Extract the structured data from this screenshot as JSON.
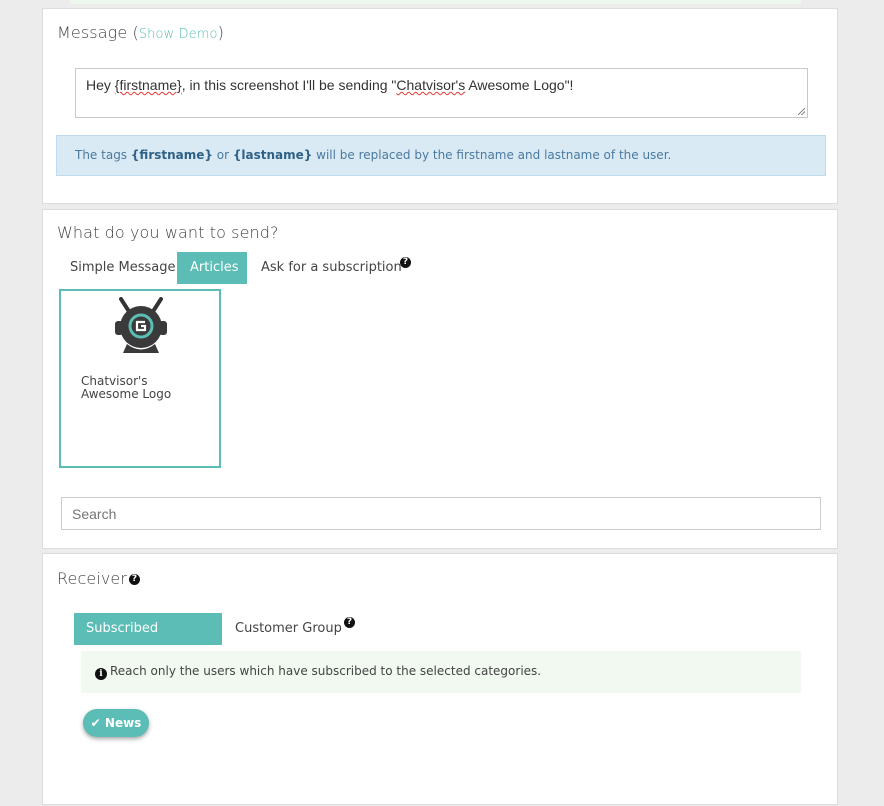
{
  "message_panel": {
    "title": "Message",
    "open_paren": "(",
    "show_demo_link": "Show Demo",
    "close_paren": ")",
    "message_parts": [
      "Hey ",
      "{firstname}",
      ", in this screenshot I'll be sending \"",
      "Chatvisor's",
      " Awesome Logo\"!"
    ],
    "info_parts": [
      "The tags ",
      "{firstname}",
      " or ",
      "{lastname}",
      " will be replaced by the firstname and lastname of the user."
    ]
  },
  "send_panel": {
    "title": "What do you want to send?",
    "tabs": [
      {
        "label": "Simple Message",
        "active": false
      },
      {
        "label": "Articles",
        "active": true
      },
      {
        "label": "Ask for a subscription",
        "active": false
      }
    ],
    "help_icon": "question-circle-icon",
    "articles": [
      {
        "title": "Chatvisor's Awesome Logo",
        "selected": true
      }
    ],
    "search": {
      "placeholder": "Search"
    }
  },
  "receiver_panel": {
    "title": "Receiver",
    "help_icon": "question-circle-icon",
    "tabs": [
      {
        "label": "Subscribed Category",
        "active": true
      },
      {
        "label": "Customer Group",
        "active": false
      }
    ],
    "info_text": "Reach only the users which have subscribed to the selected categories.",
    "categories": [
      {
        "label": "News",
        "selected": true,
        "icon": "check-icon"
      }
    ]
  },
  "colors": {
    "accent": "#5bbdb5",
    "info_blue_bg": "#d9eaf4",
    "info_green_bg": "#f1f9f0"
  }
}
